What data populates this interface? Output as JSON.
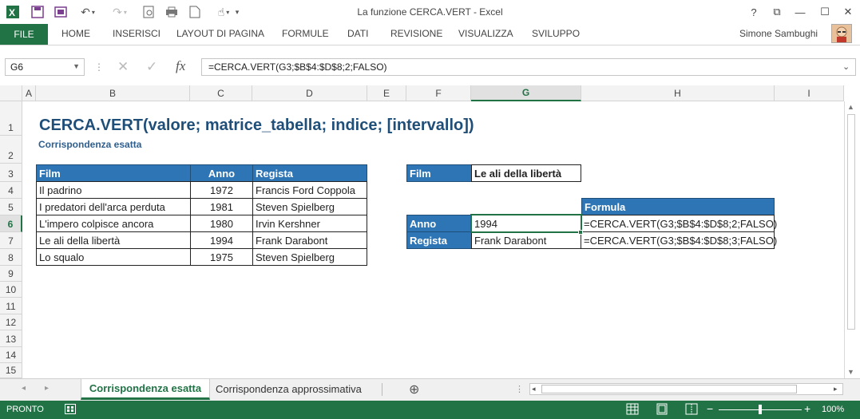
{
  "window": {
    "title": "La funzione CERCA.VERT - Excel",
    "help": "?",
    "restore_ribbon": "⧉",
    "minimize": "—",
    "maximize": "☐",
    "close": "✕"
  },
  "ribbon": {
    "file": "FILE",
    "tabs": [
      "HOME",
      "INSERISCI",
      "LAYOUT DI PAGINA",
      "FORMULE",
      "DATI",
      "REVISIONE",
      "VISUALIZZA",
      "SVILUPPO"
    ],
    "user": "Simone Sambughi"
  },
  "formula_bar": {
    "name_box": "G6",
    "cancel": "✕",
    "enter": "✓",
    "fx": "fx",
    "formula": "=CERCA.VERT(G3;$B$4:$D$8;2;FALSO)"
  },
  "grid": {
    "columns": [
      "A",
      "B",
      "C",
      "D",
      "E",
      "F",
      "G",
      "H",
      "I"
    ],
    "rows": [
      "1",
      "2",
      "3",
      "4",
      "5",
      "6",
      "7",
      "8",
      "9",
      "10",
      "11",
      "12",
      "13",
      "14",
      "15"
    ],
    "selected_column": "G",
    "selected_row": "6"
  },
  "sheet": {
    "title": "CERCA.VERT(valore; matrice_tabella; indice; [intervallo])",
    "subtitle": "Corrispondenza esatta",
    "table_headers": [
      "Film",
      "Anno",
      "Regista"
    ],
    "table_rows": [
      [
        "Il padrino",
        "1972",
        "Francis Ford Coppola"
      ],
      [
        "I predatori dell'arca perduta",
        "1981",
        "Steven Spielberg"
      ],
      [
        "L'impero colpisce ancora",
        "1980",
        "Irvin Kershner"
      ],
      [
        "Le ali della libertà",
        "1994",
        "Frank Darabont"
      ],
      [
        "Lo squalo",
        "1975",
        "Steven Spielberg"
      ]
    ],
    "lookup_label": "Film",
    "lookup_value": "Le ali della libertà",
    "formula_header": "Formula",
    "result_rows": [
      {
        "label": "Anno",
        "value": "1994",
        "formula": "=CERCA.VERT(G3;$B$4:$D$8;2;FALSO)"
      },
      {
        "label": "Regista",
        "value": "Frank Darabont",
        "formula": "=CERCA.VERT(G3;$B$4:$D$8;3;FALSO)"
      }
    ]
  },
  "sheet_tabs": {
    "active": "Corrispondenza esatta",
    "other": "Corrispondenza approssimativa",
    "add": "⊕"
  },
  "status": {
    "mode": "PRONTO",
    "zoom": "100%",
    "zoom_minus": "−",
    "zoom_plus": "+"
  },
  "colors": {
    "excel_green": "#217346",
    "header_blue": "#2e75b6",
    "title_blue": "#1f4e79"
  }
}
